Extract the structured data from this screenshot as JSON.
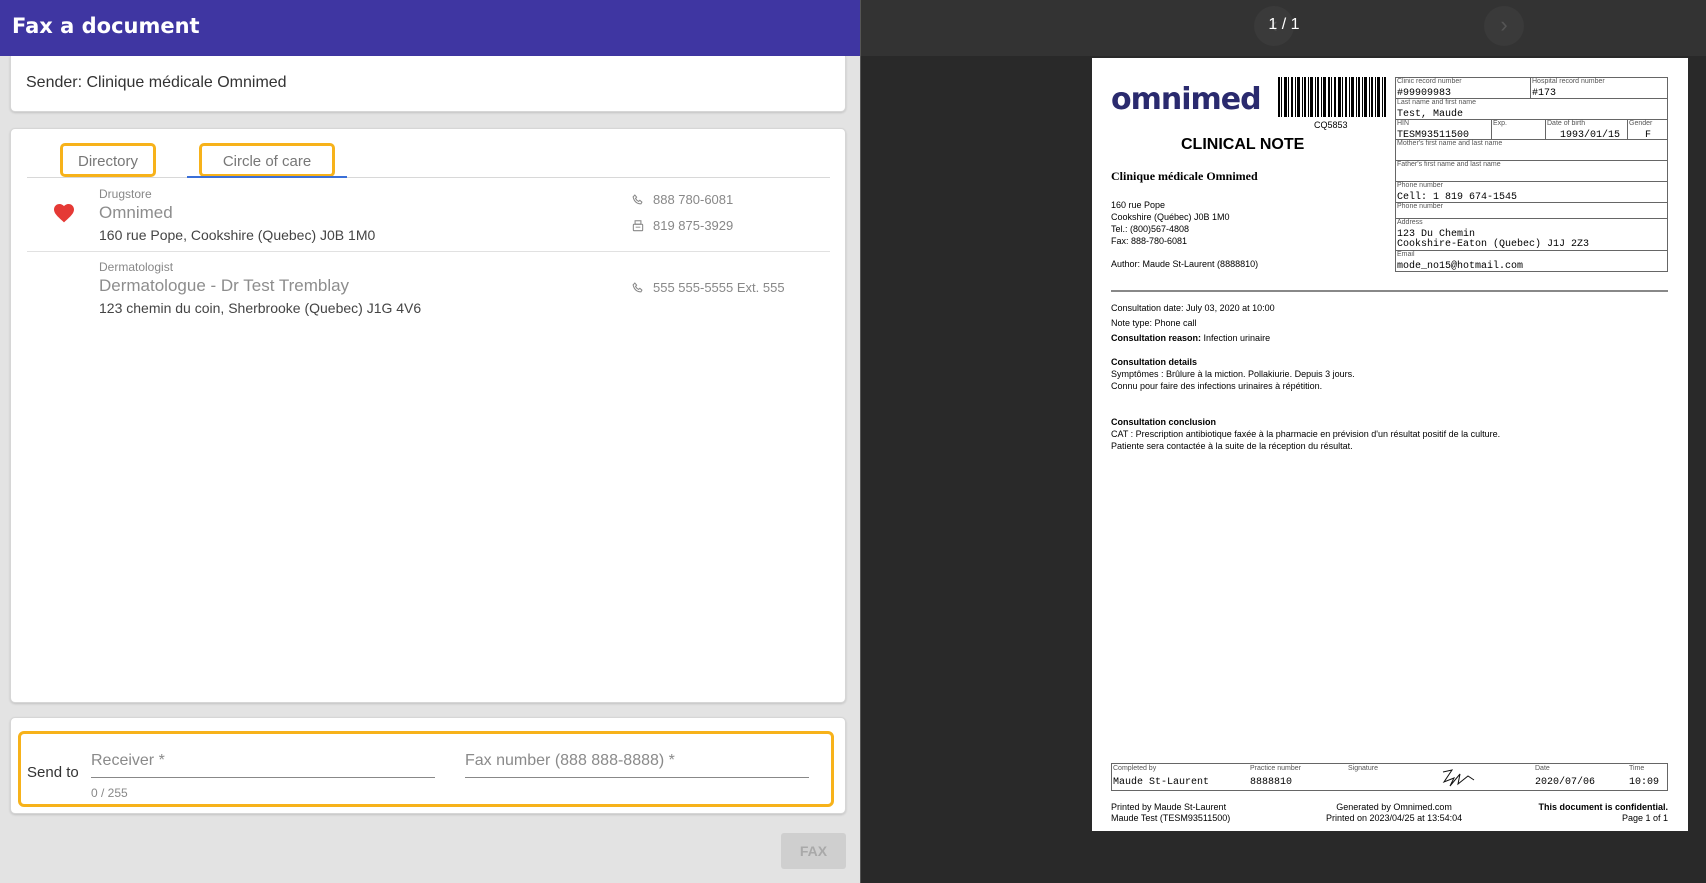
{
  "header": {
    "title": "Fax a document"
  },
  "sender": {
    "text": "Sender: Clinique médicale Omnimed"
  },
  "tabs": [
    {
      "label": "Directory",
      "selected": false
    },
    {
      "label": "Circle of care",
      "selected": true
    }
  ],
  "contacts": [
    {
      "category": "Drugstore",
      "name": "Omnimed",
      "address": "160 rue Pope, Cookshire (Quebec) J0B 1M0",
      "favorite": true,
      "phone": "888 780-6081",
      "fax": "819 875-3929"
    },
    {
      "category": "Dermatologist",
      "name": "Dermatologue - Dr Test Tremblay",
      "address": "123 chemin du coin, Sherbrooke (Quebec) J1G 4V6",
      "favorite": false,
      "phone": "555 555-5555 Ext. 555"
    }
  ],
  "send": {
    "label": "Send to",
    "receiver_placeholder": "Receiver *",
    "fax_placeholder": "Fax number (888 888-8888) *",
    "counter": "0 / 255",
    "fax_button": "FAX"
  },
  "viewer": {
    "pager": "1 / 1",
    "prev_icon": "chevron-left-icon",
    "next_icon": "chevron-right-icon"
  },
  "document": {
    "logo": "omnimed",
    "barcode_number": "CQ5853",
    "title": "CLINICAL NOTE",
    "clinic_name": "Clinique médicale Omnimed",
    "clinic_address_lines": [
      "160 rue Pope",
      "Cookshire (Québec)  J0B 1M0",
      "Tel.: (800)567-4808",
      "Fax: 888-780-6081"
    ],
    "author": "Author: Maude St-Laurent (8888810)",
    "patient": {
      "clinic_record_label": "Clinic record number",
      "clinic_record": "#99909983",
      "hospital_record_label": "Hospital record number",
      "hospital_record": "#173",
      "name_label": "Last name and first name",
      "name": "Test, Maude",
      "hin_label": "HIN",
      "hin": "TESM93511500",
      "exp_label": "Exp.",
      "dob_label": "Date of birth",
      "dob": "1993/01/15",
      "gender_label": "Gender",
      "gender": "F",
      "mother_label": "Mother's first name and last name",
      "father_label": "Father's first name and last name",
      "phone_label": "Phone number",
      "phone": "Cell: 1 819 674-1545",
      "phone2_label": "Phone number",
      "address_label": "Address",
      "address_line1": "123 Du Chemin",
      "address_line2": "Cookshire-Eaton (Quebec)  J1J 2Z3",
      "email_label": "Email",
      "email": "mode_no15@hotmail.com"
    },
    "consultation_date": "Consultation date: July 03, 2020 at 10:00",
    "note_type": "Note type: Phone call",
    "reason_label": "Consultation reason:",
    "reason": "Infection urinaire",
    "details_label": "Consultation details",
    "details_line1": "Symptômes : Brûlure à la miction. Pollakiurie. Depuis 3 jours.",
    "details_line2": "Connu pour faire des infections urinaires à répétition.",
    "conclusion_label": "Consultation conclusion",
    "conclusion_line1": "CAT : Prescription antibiotique faxée à la pharmacie en prévision d'un résultat positif de la culture.",
    "conclusion_line2": "Patiente sera contactée à la suite de la réception du résultat.",
    "footer": {
      "completed_label": "Completed by",
      "completed": "Maude St-Laurent",
      "practice_label": "Practice number",
      "practice": "8888810",
      "signature_label": "Signature",
      "date_label": "Date",
      "date": "2020/07/06",
      "time_label": "Time",
      "time": "10:09"
    },
    "printed_by_line1": "Printed by Maude St-Laurent",
    "printed_by_line2": "Maude Test (TESM93511500)",
    "generated_line1": "Generated by Omnimed.com",
    "generated_line2": "Printed on 2023/04/25 at 13:54:04",
    "confidential": "This document is confidential.",
    "page": "Page 1 of 1"
  },
  "colors": {
    "header": "#3f36a2",
    "highlight": "#f7b21a",
    "tab_underline": "#3a6fd8",
    "heart": "#e53935"
  }
}
